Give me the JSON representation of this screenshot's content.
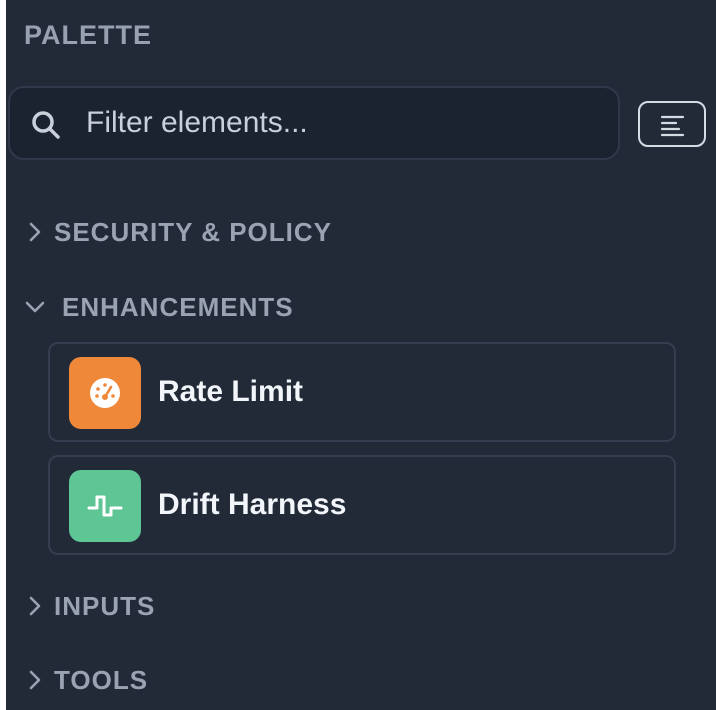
{
  "palette": {
    "title": "PALETTE",
    "search": {
      "placeholder": "Filter elements..."
    },
    "view_toggle_icon": "align-left-icon",
    "categories": [
      {
        "label": "SECURITY & POLICY",
        "expanded": false,
        "icon": "chevron-right-icon"
      },
      {
        "label": "ENHANCEMENTS",
        "expanded": true,
        "icon": "chevron-down-icon",
        "items": [
          {
            "label": "Rate Limit",
            "icon": "gauge-icon",
            "color": "#f0883a"
          },
          {
            "label": "Drift Harness",
            "icon": "pulse-icon",
            "color": "#5ec594"
          }
        ]
      },
      {
        "label": "INPUTS",
        "expanded": false,
        "icon": "chevron-right-icon"
      },
      {
        "label": "TOOLS",
        "expanded": false,
        "icon": "chevron-right-icon"
      }
    ]
  }
}
